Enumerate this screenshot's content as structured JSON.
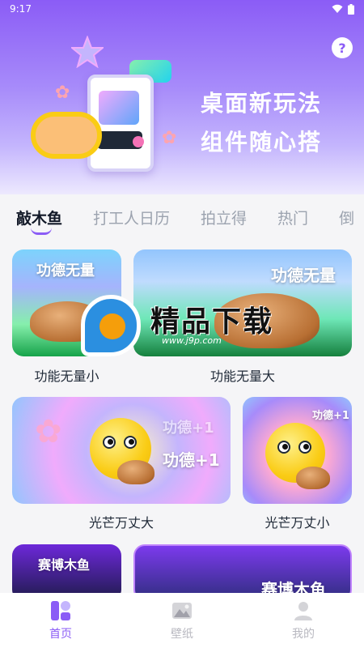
{
  "status_bar": {
    "time": "9:17"
  },
  "hero": {
    "line1": "桌面新玩法",
    "line2": "组件随心搭",
    "help_icon": "question-circle-icon"
  },
  "tabs": [
    {
      "label": "敲木鱼",
      "active": true
    },
    {
      "label": "打工人日历",
      "active": false
    },
    {
      "label": "拍立得",
      "active": false
    },
    {
      "label": "热门",
      "active": false
    },
    {
      "label": "倒",
      "active": false
    }
  ],
  "cards": [
    {
      "overlay": "功德无量",
      "caption": "功能无量小"
    },
    {
      "overlay": "功德无量",
      "caption": "功能无量大"
    },
    {
      "overlay1": "功德+1",
      "overlay2": "功德+1",
      "caption": "光芒万丈大"
    },
    {
      "overlay": "功德+1",
      "caption": "光芒万丈小"
    },
    {
      "overlay": "赛博木鱼"
    },
    {
      "overlay": "赛博木鱼"
    }
  ],
  "watermark": {
    "text": "精品下载",
    "url": "www.j9p.com"
  },
  "bottom_nav": [
    {
      "label": "首页",
      "icon": "home-grid-icon",
      "active": true
    },
    {
      "label": "壁纸",
      "icon": "wallpaper-mountain-icon",
      "active": false
    },
    {
      "label": "我的",
      "icon": "user-profile-icon",
      "active": false
    }
  ],
  "colors": {
    "accent": "#8b5cf6",
    "inactive": "#b8b8c0"
  }
}
